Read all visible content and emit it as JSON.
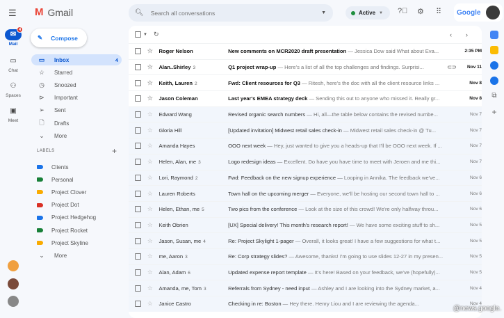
{
  "app": {
    "name": "Gmail",
    "watermark": "@news.google."
  },
  "rail": [
    {
      "label": "Mail",
      "badge": "4",
      "icon": "mail-icon"
    },
    {
      "label": "Chat",
      "icon": "chat-icon"
    },
    {
      "label": "Spaces",
      "icon": "spaces-icon"
    },
    {
      "label": "Meet",
      "icon": "meet-icon"
    }
  ],
  "compose": "Compose",
  "nav": [
    {
      "label": "Inbox",
      "count": "4"
    },
    {
      "label": "Starred"
    },
    {
      "label": "Snoozed"
    },
    {
      "label": "Important"
    },
    {
      "label": "Sent"
    },
    {
      "label": "Drafts"
    },
    {
      "label": "More"
    }
  ],
  "labels_header": "LABELS",
  "labels": [
    {
      "label": "Clients",
      "color": "#1a73e8"
    },
    {
      "label": "Personal",
      "color": "#188038"
    },
    {
      "label": "Project Clover",
      "color": "#f9ab00"
    },
    {
      "label": "Project Dot",
      "color": "#d93025"
    },
    {
      "label": "Project Hedgehog",
      "color": "#1a73e8"
    },
    {
      "label": "Project Rocket",
      "color": "#188038"
    },
    {
      "label": "Project Skyline",
      "color": "#f9ab00"
    }
  ],
  "labels_more": "More",
  "search": {
    "placeholder": "Search all conversations"
  },
  "status": "Active",
  "google": "Google",
  "emails": [
    {
      "from": "Roger Nelson",
      "n": "",
      "subject": "New comments on MCR2020 draft presentation",
      "snippet": " — Jessica Dow said What about Eva...",
      "date": "2:35 PM",
      "unread": true
    },
    {
      "from": "Alan..Shirley",
      "n": "3",
      "subject": "Q1 project wrap-up",
      "snippet": " — Here's a list of all the top challenges and findings. Surprisi...",
      "date": "Nov 11",
      "unread": true,
      "attach": true
    },
    {
      "from": "Keith, Lauren",
      "n": "2",
      "subject": "Fwd: Client resources for Q3",
      "snippet": " — Ritesh, here's the doc with all the client resource links ...",
      "date": "Nov 8",
      "unread": true
    },
    {
      "from": "Jason Coleman",
      "n": "",
      "subject": "Last year's EMEA strategy deck",
      "snippet": " — Sending this out to anyone who missed it. Really gr...",
      "date": "Nov 8",
      "unread": true
    },
    {
      "from": "Edward Wang",
      "n": "",
      "subject": "Revised organic search numbers",
      "snippet": " — Hi, all—the table below contains the revised numbe...",
      "date": "Nov 7"
    },
    {
      "from": "Gloria Hill",
      "n": "",
      "subject": "[Updated invitation] Midwest retail sales check-in",
      "snippet": " — Midwest retail sales check-in @ Tu...",
      "date": "Nov 7"
    },
    {
      "from": "Amanda Hayes",
      "n": "",
      "subject": "OOO next week",
      "snippet": " — Hey, just wanted to give you a heads-up that I'll be OOO next week. If ...",
      "date": "Nov 7"
    },
    {
      "from": "Helen, Alan, me",
      "n": "3",
      "subject": "Logo redesign ideas",
      "snippet": " — Excellent. Do have you have time to meet with Jeroen and me thi...",
      "date": "Nov 7"
    },
    {
      "from": "Lori, Raymond",
      "n": "2",
      "subject": "Fwd: Feedback on the new signup experience",
      "snippet": " — Looping in Annika. The feedback we've...",
      "date": "Nov 6"
    },
    {
      "from": "Lauren Roberts",
      "n": "",
      "subject": "Town hall on the upcoming merger",
      "snippet": " — Everyone, we'll be hosting our second town hall to ...",
      "date": "Nov 6"
    },
    {
      "from": "Helen, Ethan, me",
      "n": "5",
      "subject": "Two pics from the conference",
      "snippet": " — Look at the size of this crowd! We're only halfway throu...",
      "date": "Nov 6"
    },
    {
      "from": "Keith Obrien",
      "n": "",
      "subject": "[UX] Special delivery! This month's research report!",
      "snippet": " — We have some exciting stuff to sh...",
      "date": "Nov 5"
    },
    {
      "from": "Jason, Susan, me",
      "n": "4",
      "subject": "Re: Project Skylight 1-pager",
      "snippet": " — Overall, it looks great! I have a few suggestions for what t...",
      "date": "Nov 5"
    },
    {
      "from": "me, Aaron",
      "n": "3",
      "subject": "Re: Corp strategy slides?",
      "snippet": " — Awesome, thanks! I'm going to use slides 12-27 in my presen...",
      "date": "Nov 5"
    },
    {
      "from": "Alan, Adam",
      "n": "6",
      "subject": "Updated expense report template",
      "snippet": " — It's here! Based on your feedback, we've (hopefully)...",
      "date": "Nov 5"
    },
    {
      "from": "Amanda, me, Tom",
      "n": "3",
      "subject": "Referrals from Sydney - need input",
      "snippet": " — Ashley and I are looking into the Sydney market, a...",
      "date": "Nov 4"
    },
    {
      "from": "Janice Castro",
      "n": "",
      "subject": "Checking in re: Boston",
      "snippet": " — Hey there. Henry Liou and I are reviewing the agenda...",
      "date": "Nov 4"
    }
  ]
}
